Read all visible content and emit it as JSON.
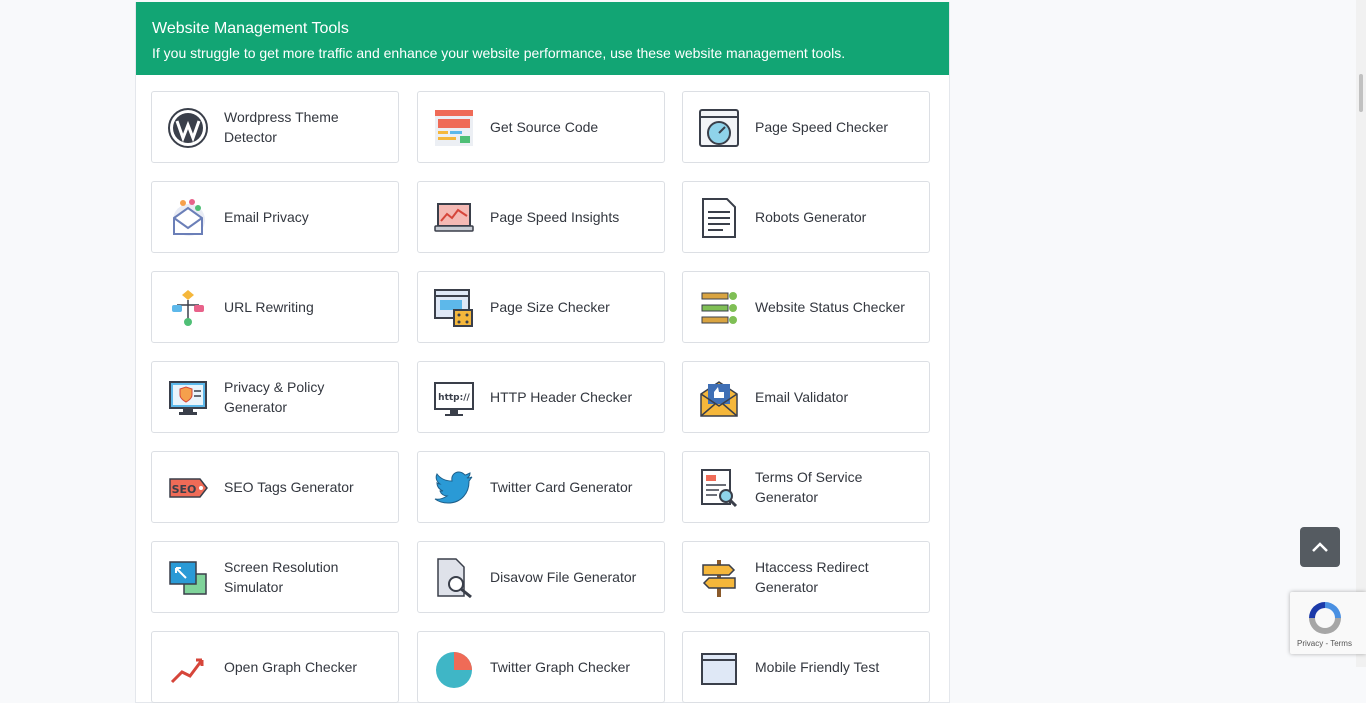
{
  "header": {
    "title": "Website Management Tools",
    "subtitle": "If you struggle to get more traffic and enhance your website performance, use these website management tools."
  },
  "tools": [
    {
      "label": "Wordpress Theme Detector",
      "icon": "wordpress-icon"
    },
    {
      "label": "Get Source Code",
      "icon": "source-code-icon"
    },
    {
      "label": "Page Speed Checker",
      "icon": "speedometer-icon"
    },
    {
      "label": "Email Privacy",
      "icon": "email-privacy-icon"
    },
    {
      "label": "Page Speed Insights",
      "icon": "laptop-chart-icon"
    },
    {
      "label": "Robots Generator",
      "icon": "document-icon"
    },
    {
      "label": "URL Rewriting",
      "icon": "flowchart-icon"
    },
    {
      "label": "Page Size Checker",
      "icon": "page-size-icon"
    },
    {
      "label": "Website Status Checker",
      "icon": "server-status-icon"
    },
    {
      "label": "Privacy & Policy Generator",
      "icon": "monitor-shield-icon"
    },
    {
      "label": "HTTP Header Checker",
      "icon": "http-monitor-icon"
    },
    {
      "label": "Email Validator",
      "icon": "envelope-thumbs-up-icon"
    },
    {
      "label": "SEO Tags Generator",
      "icon": "seo-tag-icon"
    },
    {
      "label": "Twitter Card Generator",
      "icon": "twitter-bird-icon"
    },
    {
      "label": "Terms Of Service Generator",
      "icon": "terms-document-icon"
    },
    {
      "label": "Screen Resolution Simulator",
      "icon": "screen-resize-icon"
    },
    {
      "label": "Disavow File Generator",
      "icon": "file-search-icon"
    },
    {
      "label": "Htaccess Redirect Generator",
      "icon": "signpost-icon"
    },
    {
      "label": "Open Graph Checker",
      "icon": "graph-arrow-icon"
    },
    {
      "label": "Twitter Graph Checker",
      "icon": "pie-chart-icon"
    },
    {
      "label": "Mobile Friendly Test",
      "icon": "mobile-test-icon"
    }
  ],
  "recaptcha": {
    "terms": "Privacy - Terms"
  },
  "colors": {
    "header": "#12a574",
    "scroll_top_button": "#555b61"
  }
}
